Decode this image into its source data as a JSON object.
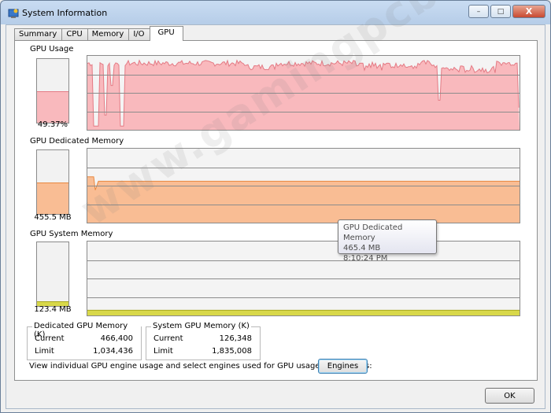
{
  "window": {
    "title": "System Information",
    "caption": {
      "minimize": "–",
      "maximize": "□",
      "close": "X"
    }
  },
  "tabs": [
    {
      "label": "Summary",
      "active": false
    },
    {
      "label": "CPU",
      "active": false
    },
    {
      "label": "Memory",
      "active": false
    },
    {
      "label": "I/O",
      "active": false
    },
    {
      "label": "GPU",
      "active": true
    }
  ],
  "sections": {
    "gpu_usage": {
      "label": "GPU Usage",
      "value": "49.37%",
      "fraction": 0.4937
    },
    "dedicated": {
      "label": "GPU Dedicated Memory",
      "value": "455.5 MB",
      "fraction": 0.5
    },
    "system": {
      "label": "GPU System Memory",
      "value": "123.4 MB",
      "fraction": 0.07
    }
  },
  "stats": {
    "dedicated": {
      "title": "Dedicated GPU Memory (K)",
      "rows": [
        {
          "label": "Current",
          "value": "466,400"
        },
        {
          "label": "Limit",
          "value": "1,034,436"
        }
      ]
    },
    "system": {
      "title": "System GPU Memory (K)",
      "rows": [
        {
          "label": "Current",
          "value": "126,348"
        },
        {
          "label": "Limit",
          "value": "1,835,008"
        }
      ]
    }
  },
  "engines": {
    "text": "View individual GPU engine usage and select engines used for GPU usage calculations:",
    "button": "Engines"
  },
  "ok_button": "OK",
  "tooltip": {
    "title": "GPU Dedicated Memory",
    "value": "465.4 MB",
    "time": "8:10:24 PM"
  },
  "watermark": "www.gamingpcbuilder.com",
  "colors": {
    "usage_fill": "#f9b9bd",
    "usage_line": "#e47a84",
    "dedicated_fill": "#f9bd94",
    "dedicated_line": "#e88840",
    "system_fill": "#d8d84a",
    "system_line": "#a8a820"
  }
}
